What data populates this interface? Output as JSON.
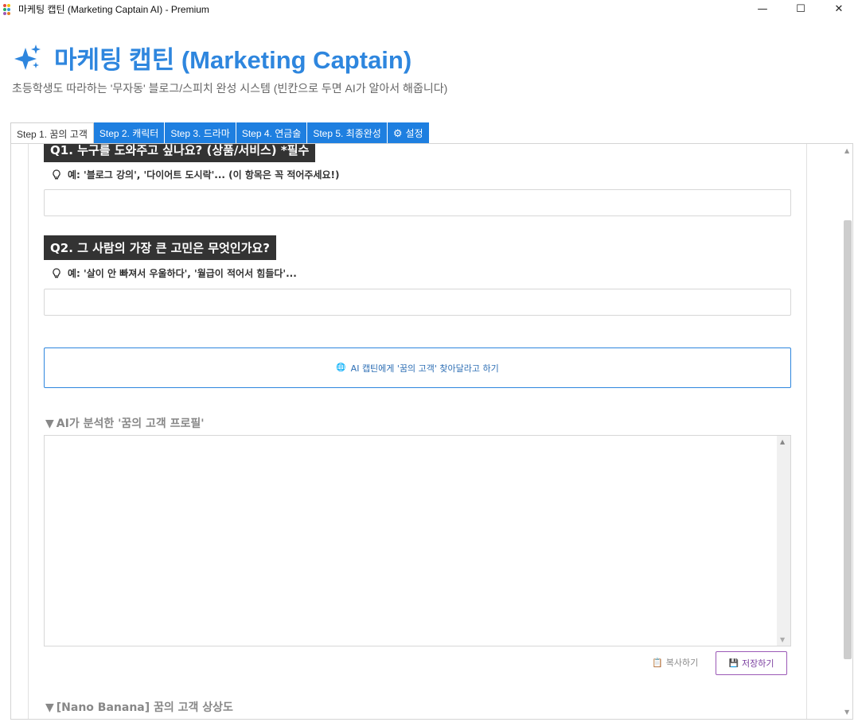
{
  "window": {
    "title": "마케팅 캡틴 (Marketing Captain AI) - Premium",
    "minimize": "—",
    "maximize": "☐",
    "close": "✕"
  },
  "header": {
    "title": "마케팅 캡틴 (Marketing Captain)",
    "subtitle": "초등학생도 따라하는 '무자동' 블로그/스피치 완성 시스템 (빈칸으로 두면 AI가 알아서 해줍니다)"
  },
  "tabs": [
    {
      "label": "Step 1. 꿈의 고객"
    },
    {
      "label": "Step 2. 캐릭터"
    },
    {
      "label": "Step 3. 드라마"
    },
    {
      "label": "Step 4. 연금술"
    },
    {
      "label": "Step 5. 최종완성"
    },
    {
      "label": "설정"
    }
  ],
  "q1": {
    "label": "Q1. 누구를 도와주고 싶나요? (상품/서비스) *필수",
    "hint": "예: '블로그 강의', '다이어트 도시락'... (이 항목은 꼭 적어주세요!)",
    "value": ""
  },
  "q2": {
    "label": "Q2. 그 사람의 가장 큰 고민은 무엇인가요?",
    "hint": "예: '살이 안 빠져서 우울하다', '월급이 적어서 힘들다'...",
    "value": ""
  },
  "ai_button": {
    "label": "AI 캡틴에게 '꿈의 고객' 찾아달라고 하기"
  },
  "profile_section": {
    "arrow": "▼",
    "title": "AI가 분석한 '꿈의 고객 프로필'",
    "value": ""
  },
  "actions": {
    "copy": "복사하기",
    "save": "저장하기"
  },
  "image_section": {
    "arrow": "▼",
    "title": "[Nano Banana] 꿈의 고객 상상도"
  },
  "colors": {
    "accent": "#2e86de",
    "tab_bg": "#1e7fe0",
    "label_bg": "#333333",
    "save_border": "#9b59b6"
  }
}
